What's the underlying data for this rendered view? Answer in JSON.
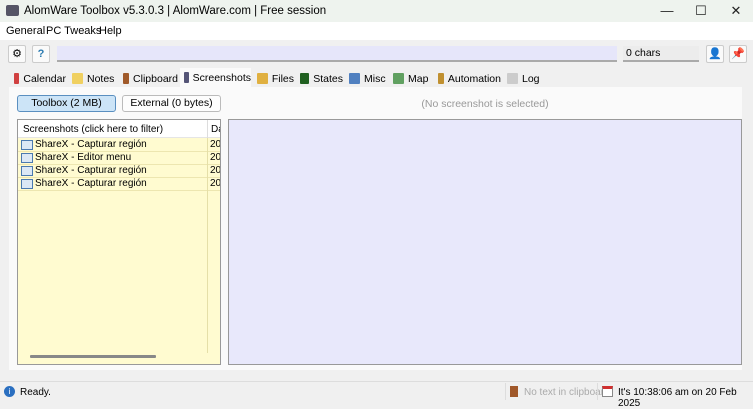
{
  "window": {
    "title": "AlomWare Toolbox v5.3.0.3  |  AlomWare.com  |  Free session",
    "minimize": "—",
    "maximize": "☐",
    "close": "✕"
  },
  "menu": [
    "General",
    "PC Tweaks",
    "Help"
  ],
  "toolbar": {
    "command_value": "",
    "chars": "0 chars"
  },
  "tabs": [
    {
      "label": "Calendar",
      "color": "#d04040"
    },
    {
      "label": "Notes",
      "color": "#f0d060"
    },
    {
      "label": "Clipboard",
      "color": "#a05a2a"
    },
    {
      "label": "Screenshots",
      "color": "#555577"
    },
    {
      "label": "Files",
      "color": "#e0b040"
    },
    {
      "label": "States",
      "color": "#206020"
    },
    {
      "label": "Misc",
      "color": "#5080c0"
    },
    {
      "label": "Map",
      "color": "#60a060"
    },
    {
      "label": "Automation",
      "color": "#c09030"
    },
    {
      "label": "Log",
      "color": "#cccccc"
    }
  ],
  "active_tab": "Screenshots",
  "screenshots": {
    "toolbox_button": "Toolbox (2 MB)",
    "external_button": "External (0 bytes)",
    "preview_message": "(No screenshot is selected)",
    "columns": [
      "Screenshots  (click here to filter)",
      "Da"
    ],
    "rows": [
      {
        "name": "ShareX - Capturar región",
        "date": "20"
      },
      {
        "name": "ShareX - Editor menu",
        "date": "20"
      },
      {
        "name": "ShareX - Capturar región",
        "date": "20"
      },
      {
        "name": "ShareX - Capturar región",
        "date": "20"
      }
    ]
  },
  "status": {
    "text": "Ready.",
    "clipboard": "No text in clipboard",
    "clock": "It's 10:38:06 am on 20 Feb 2025"
  }
}
